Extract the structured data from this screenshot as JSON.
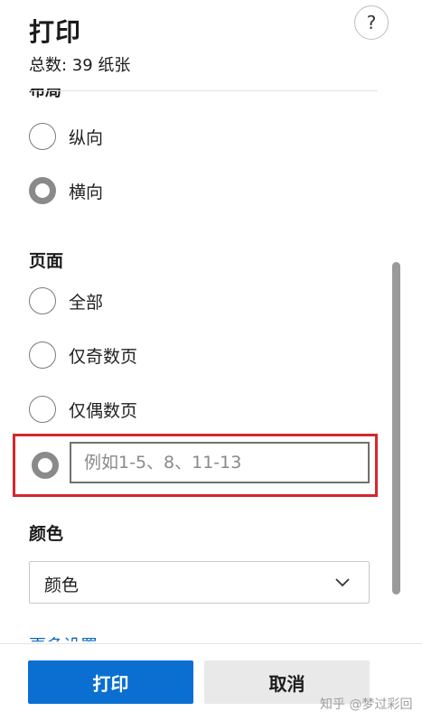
{
  "header": {
    "title": "打印",
    "subtitle": "总数: 39 纸张",
    "help_glyph": "?"
  },
  "layout_section": {
    "heading_partial": "布局",
    "options": [
      {
        "label": "纵向",
        "selected": false
      },
      {
        "label": "横向",
        "selected": true
      }
    ]
  },
  "pages_section": {
    "heading": "页面",
    "options": [
      {
        "label": "全部",
        "selected": false
      },
      {
        "label": "仅奇数页",
        "selected": false
      },
      {
        "label": "仅偶数页",
        "selected": false
      }
    ],
    "custom_range": {
      "selected": true,
      "placeholder": "例如1-5、8、11-13",
      "value": ""
    }
  },
  "color_section": {
    "heading": "颜色",
    "selected_value": "颜色"
  },
  "more_settings_link": "更多设置",
  "footer": {
    "print_label": "打印",
    "cancel_label": "取消",
    "watermark": "知乎 @梦过彩回"
  },
  "colors": {
    "primary": "#0a6fd1",
    "highlight_border": "#d7262d",
    "link": "#0a66c2"
  }
}
